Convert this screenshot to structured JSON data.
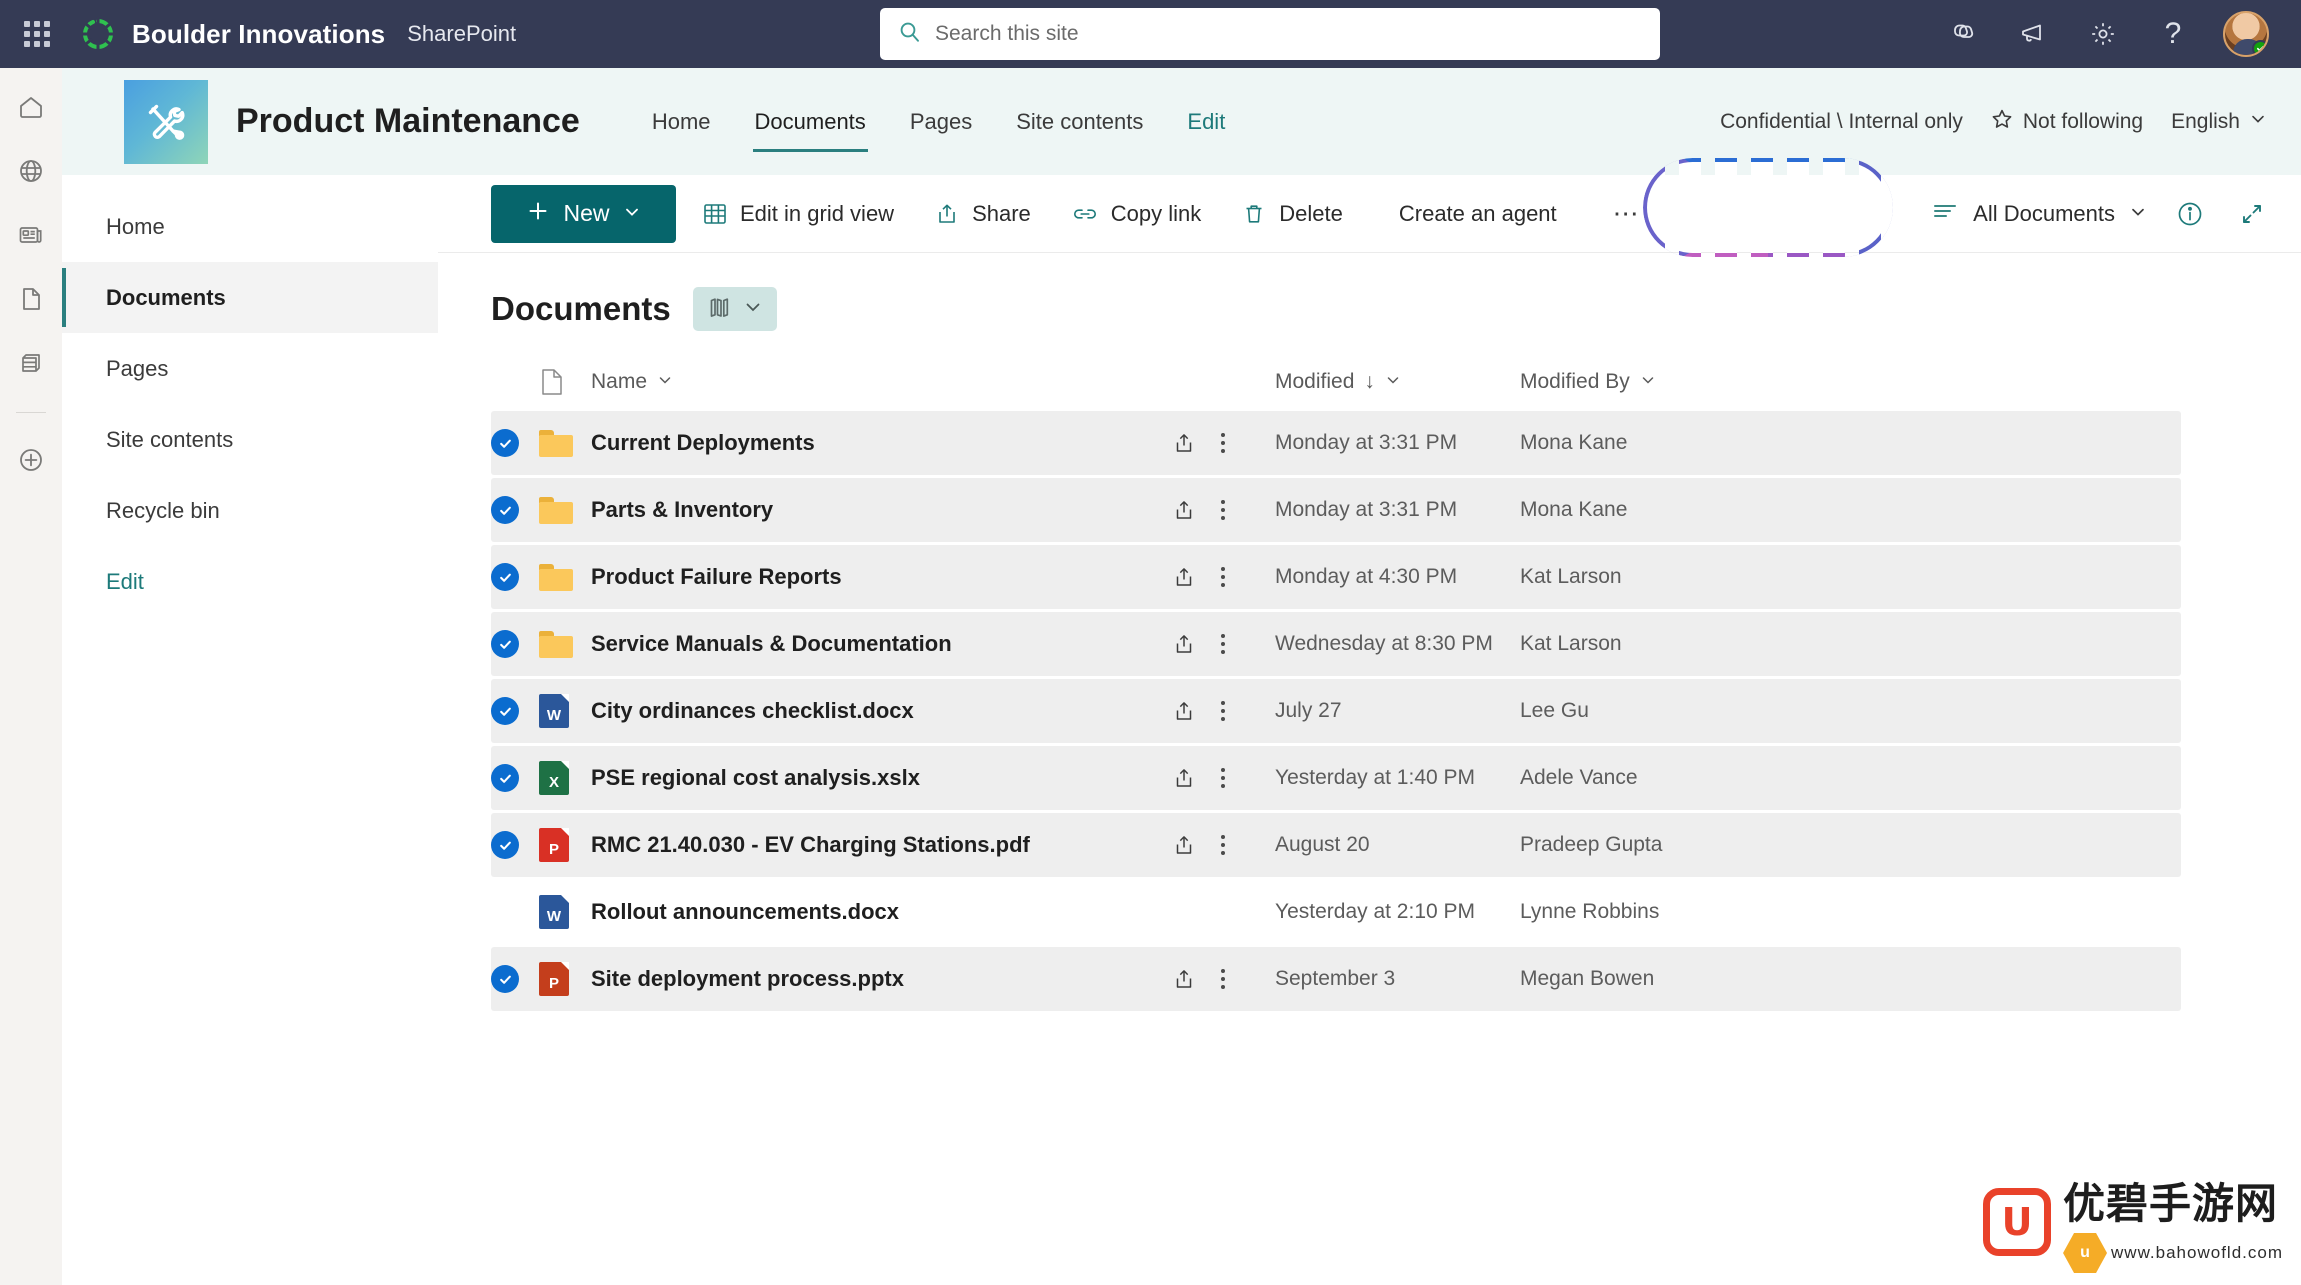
{
  "suite": {
    "waffle_label": "app-launcher",
    "brand": "Boulder Innovations",
    "app_name": "SharePoint",
    "search_placeholder": "Search this site",
    "search_value": "",
    "icons": [
      "copilot-icon",
      "megaphone-icon",
      "gear-icon",
      "help-icon"
    ],
    "help_glyph": "?"
  },
  "rail": {
    "items": [
      "home-icon",
      "globe-icon",
      "news-icon",
      "page-icon",
      "lists-icon",
      "create-icon"
    ]
  },
  "site": {
    "title": "Product Maintenance",
    "logo": "tools-icon",
    "nav": [
      {
        "label": "Home",
        "active": false
      },
      {
        "label": "Documents",
        "active": true
      },
      {
        "label": "Pages",
        "active": false
      },
      {
        "label": "Site contents",
        "active": false
      },
      {
        "label": "Edit",
        "active": false,
        "link": true
      }
    ],
    "sensitivity": "Confidential \\ Internal only",
    "follow": "Not following",
    "language": "English"
  },
  "leftnav": {
    "items": [
      {
        "label": "Home",
        "selected": false
      },
      {
        "label": "Documents",
        "selected": true
      },
      {
        "label": "Pages",
        "selected": false
      },
      {
        "label": "Site contents",
        "selected": false
      },
      {
        "label": "Recycle bin",
        "selected": false
      },
      {
        "label": "Edit",
        "selected": false,
        "edit": true
      }
    ]
  },
  "toolbar": {
    "new_label": "New",
    "commands": [
      {
        "label": "Edit in grid view",
        "icon": "grid-icon"
      },
      {
        "label": "Share",
        "icon": "share-icon"
      },
      {
        "label": "Copy link",
        "icon": "link-icon"
      },
      {
        "label": "Delete",
        "icon": "trash-icon"
      }
    ],
    "agent_label": "Create an agent",
    "overflow_label": "⋯",
    "view_label": "All Documents",
    "info_icon": "info-icon",
    "expand_icon": "expand-icon"
  },
  "library": {
    "title": "Documents",
    "view_switch_icon": "tiles-icon",
    "columns": {
      "name": "Name",
      "modified": "Modified",
      "modified_by": "Modified By",
      "sort_glyph": "↓"
    },
    "rows": [
      {
        "name": "Current Deployments",
        "type": "folder",
        "modified": "Monday at 3:31 PM",
        "by": "Mona Kane",
        "selected": true
      },
      {
        "name": "Parts & Inventory",
        "type": "folder",
        "modified": "Monday at 3:31 PM",
        "by": "Mona Kane",
        "selected": true
      },
      {
        "name": "Product Failure Reports",
        "type": "folder",
        "modified": "Monday at 4:30 PM",
        "by": "Kat Larson",
        "selected": true
      },
      {
        "name": "Service Manuals & Documentation",
        "type": "folder",
        "modified": "Wednesday at 8:30 PM",
        "by": "Kat Larson",
        "selected": true
      },
      {
        "name": "City ordinances checklist.docx",
        "type": "word",
        "modified": "July 27",
        "by": "Lee Gu",
        "selected": true
      },
      {
        "name": "PSE regional cost analysis.xslx",
        "type": "excel",
        "modified": "Yesterday at 1:40 PM",
        "by": "Adele Vance",
        "selected": true
      },
      {
        "name": "RMC 21.40.030 - EV Charging Stations.pdf",
        "type": "pdf",
        "modified": "August  20",
        "by": "Pradeep Gupta",
        "selected": true
      },
      {
        "name": "Rollout announcements.docx",
        "type": "word",
        "modified": "Yesterday at 2:10 PM",
        "by": "Lynne Robbins",
        "selected": false
      },
      {
        "name": "Site deployment process.pptx",
        "type": "ppt",
        "modified": "September 3",
        "by": "Megan Bowen",
        "selected": true
      }
    ],
    "file_labels": {
      "word": "W",
      "excel": "X",
      "ppt": "P",
      "pdf": "P"
    }
  },
  "watermark": {
    "mark": "U",
    "cn": "优碧手游网",
    "en": "www.bahowofld.com",
    "hex": "u"
  },
  "colors": {
    "suite_bar": "#353b55",
    "site_header": "#eef6f5",
    "accent_teal": "#06656b",
    "nav_underline": "#2a7f7f",
    "check_blue": "#0b6ccf",
    "agent_ring_from": "#2b6dd4",
    "agent_ring_to": "#c05ec0"
  }
}
